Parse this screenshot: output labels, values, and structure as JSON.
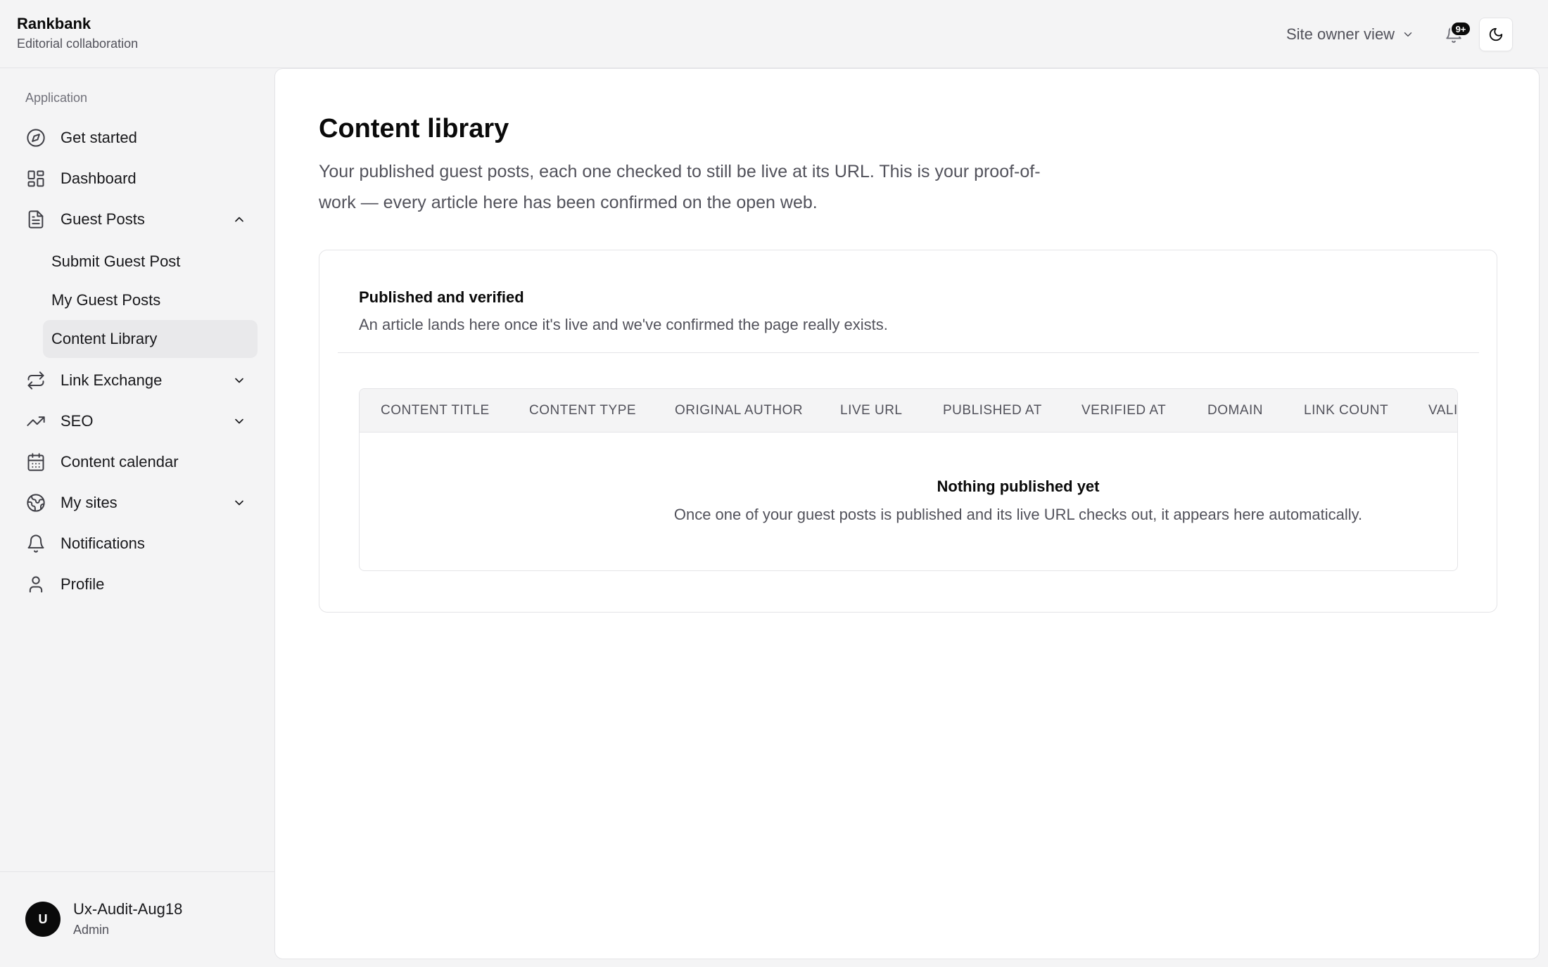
{
  "app": {
    "name": "Rankbank",
    "subtitle": "Editorial collaboration"
  },
  "header": {
    "view_switch_label": "Site owner view",
    "notifications_badge": "9+"
  },
  "sidebar": {
    "group_label": "Application",
    "items": [
      {
        "label": "Get started",
        "icon": "compass-icon"
      },
      {
        "label": "Dashboard",
        "icon": "grid-icon"
      },
      {
        "label": "Guest Posts",
        "icon": "document-icon",
        "expanded": true
      },
      {
        "label": "Link Exchange",
        "icon": "repeat-icon",
        "expanded": false
      },
      {
        "label": "SEO",
        "icon": "trending-up-icon",
        "expanded": false
      },
      {
        "label": "Content calendar",
        "icon": "calendar-icon"
      },
      {
        "label": "My sites",
        "icon": "globe-icon",
        "expanded": false
      },
      {
        "label": "Notifications",
        "icon": "bell-icon"
      },
      {
        "label": "Profile",
        "icon": "user-icon"
      }
    ],
    "guest_posts_sub": [
      {
        "label": "Submit Guest Post",
        "active": false
      },
      {
        "label": "My Guest Posts",
        "active": false
      },
      {
        "label": "Content Library",
        "active": true
      }
    ],
    "user": {
      "initial": "U",
      "name": "Ux-Audit-Aug18",
      "role": "Admin"
    }
  },
  "main": {
    "title": "Content library",
    "description": "Your published guest posts, each one checked to still be live at its URL. This is your proof-of-work — every article here has been confirmed on the open web.",
    "card": {
      "title": "Published and verified",
      "subtitle": "An article lands here once it's live and we've confirmed the page really exists.",
      "columns": [
        "Content title",
        "Content type",
        "Original author",
        "Live URL",
        "Published at",
        "Verified at",
        "Domain",
        "Link count",
        "Vali"
      ],
      "empty_title": "Nothing published yet",
      "empty_message": "Once one of your guest posts is published and its live URL checks out, it appears here automatically."
    }
  },
  "colors": {
    "background": "#f4f4f5",
    "panel": "#ffffff",
    "text": "#0a0a0a",
    "muted": "#52525b",
    "border": "#e4e4e7"
  }
}
